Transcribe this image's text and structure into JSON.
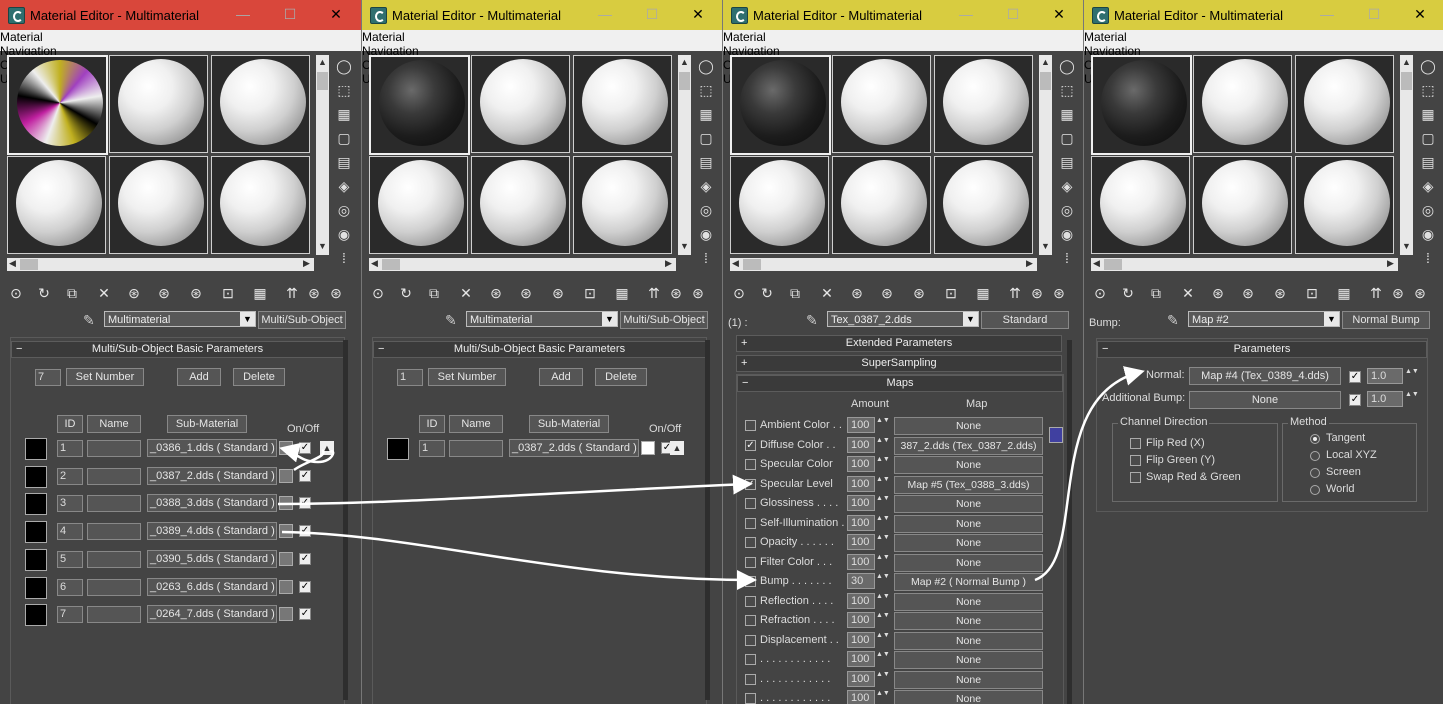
{
  "windows": [
    {
      "title": "Material Editor - Multimaterial",
      "title_bg": "#d9473b",
      "menu": [
        "Material",
        "Navigation",
        "Options",
        "Utilities"
      ],
      "name_label": "",
      "material_name": "Multimaterial",
      "material_type": "Multi/Sub-Object"
    },
    {
      "title": "Material Editor - Multimaterial",
      "title_bg": "#d8cc40",
      "menu": [
        "Material",
        "Navigation",
        "Options",
        "Utilities"
      ],
      "name_label": "",
      "material_name": "Multimaterial",
      "material_type": "Multi/Sub-Object"
    },
    {
      "title": "Material Editor - Multimaterial",
      "title_bg": "#d8cc40",
      "menu": [
        "Material",
        "Navigation",
        "Options",
        "Utilities"
      ],
      "name_label": "(1) :",
      "material_name": "Tex_0387_2.dds",
      "material_type": "Standard"
    },
    {
      "title": "Material Editor - Multimaterial",
      "title_bg": "#d8cc40",
      "menu": [
        "Material",
        "Navigation",
        "Options",
        "Utilities"
      ],
      "name_label": "Bump:",
      "material_name": "Map #2",
      "material_type": "Normal Bump"
    }
  ],
  "win_controls": {
    "minimize": "—",
    "maximize": "☐",
    "close": "✕"
  },
  "multi1": {
    "header": "Multi/Sub-Object Basic Parameters",
    "count": "7",
    "set_number": "Set Number",
    "add": "Add",
    "delete": "Delete",
    "col_id": "ID",
    "col_name": "Name",
    "col_sub": "Sub-Material",
    "col_onoff": "On/Off",
    "rows": [
      {
        "id": "1",
        "sub": "_0386_1.dds  ( Standard )",
        "color": "#cccccc"
      },
      {
        "id": "2",
        "sub": "_0387_2.dds  ( Standard )",
        "color": "#111111"
      },
      {
        "id": "3",
        "sub": "_0388_3.dds  ( Standard )",
        "color": "#a020c0"
      },
      {
        "id": "4",
        "sub": "_0389_4.dds  ( Standard )",
        "color": "#c8c020"
      },
      {
        "id": "5",
        "sub": "_0390_5.dds  ( Standard )",
        "color": "#b0b0f0"
      },
      {
        "id": "6",
        "sub": "_0263_6.dds  ( Standard )",
        "color": "#111111"
      },
      {
        "id": "7",
        "sub": "_0264_7.dds  ( Standard )",
        "color": "#050505"
      }
    ]
  },
  "multi2": {
    "header": "Multi/Sub-Object Basic Parameters",
    "count": "1",
    "set_number": "Set Number",
    "add": "Add",
    "delete": "Delete",
    "col_id": "ID",
    "col_name": "Name",
    "col_sub": "Sub-Material",
    "col_onoff": "On/Off",
    "rows": [
      {
        "id": "1",
        "sub": "_0387_2.dds  ( Standard )"
      }
    ]
  },
  "maps": {
    "extended": "Extended Parameters",
    "supersampling": "SuperSampling",
    "header": "Maps",
    "col_amount": "Amount",
    "col_map": "Map",
    "rows": [
      {
        "label": "Ambient Color . .",
        "amount": "100",
        "map": "None",
        "checked": false
      },
      {
        "label": "Diffuse Color . .",
        "amount": "100",
        "map": "387_2.dds (Tex_0387_2.dds)",
        "checked": true
      },
      {
        "label": "Specular Color",
        "amount": "100",
        "map": "None",
        "checked": false
      },
      {
        "label": "Specular Level",
        "amount": "100",
        "map": "Map #5 (Tex_0388_3.dds)",
        "checked": true
      },
      {
        "label": "Glossiness  . . . .",
        "amount": "100",
        "map": "None",
        "checked": false
      },
      {
        "label": "Self-Illumination .",
        "amount": "100",
        "map": "None",
        "checked": false
      },
      {
        "label": "Opacity  . . . . . .",
        "amount": "100",
        "map": "None",
        "checked": false
      },
      {
        "label": "Filter Color  . . .",
        "amount": "100",
        "map": "None",
        "checked": false
      },
      {
        "label": "Bump  . . . . . . .",
        "amount": "30",
        "map": "Map #2  ( Normal Bump )",
        "checked": true
      },
      {
        "label": "Reflection  . . . .",
        "amount": "100",
        "map": "None",
        "checked": false
      },
      {
        "label": "Refraction  . . . .",
        "amount": "100",
        "map": "None",
        "checked": false
      },
      {
        "label": "Displacement  . .",
        "amount": "100",
        "map": "None",
        "checked": false
      },
      {
        "label": ". . . . . . . . . . . .",
        "amount": "100",
        "map": "None",
        "checked": false
      },
      {
        "label": ". . . . . . . . . . . .",
        "amount": "100",
        "map": "None",
        "checked": false
      },
      {
        "label": ". . . . . . . . . . . .",
        "amount": "100",
        "map": "None",
        "checked": false
      }
    ]
  },
  "params": {
    "header": "Parameters",
    "normal_label": "Normal:",
    "normal_map": "Map #4 (Tex_0389_4.dds)",
    "normal_value": "1.0",
    "addbump_label": "Additional Bump:",
    "addbump_map": "None",
    "addbump_value": "1.0",
    "channel_title": "Channel Direction",
    "flip_red": "Flip Red (X)",
    "flip_green": "Flip Green (Y)",
    "swap": "Swap Red & Green",
    "method_title": "Method",
    "methods": [
      "Tangent",
      "Local XYZ",
      "Screen",
      "World"
    ],
    "method_selected": "Tangent"
  }
}
